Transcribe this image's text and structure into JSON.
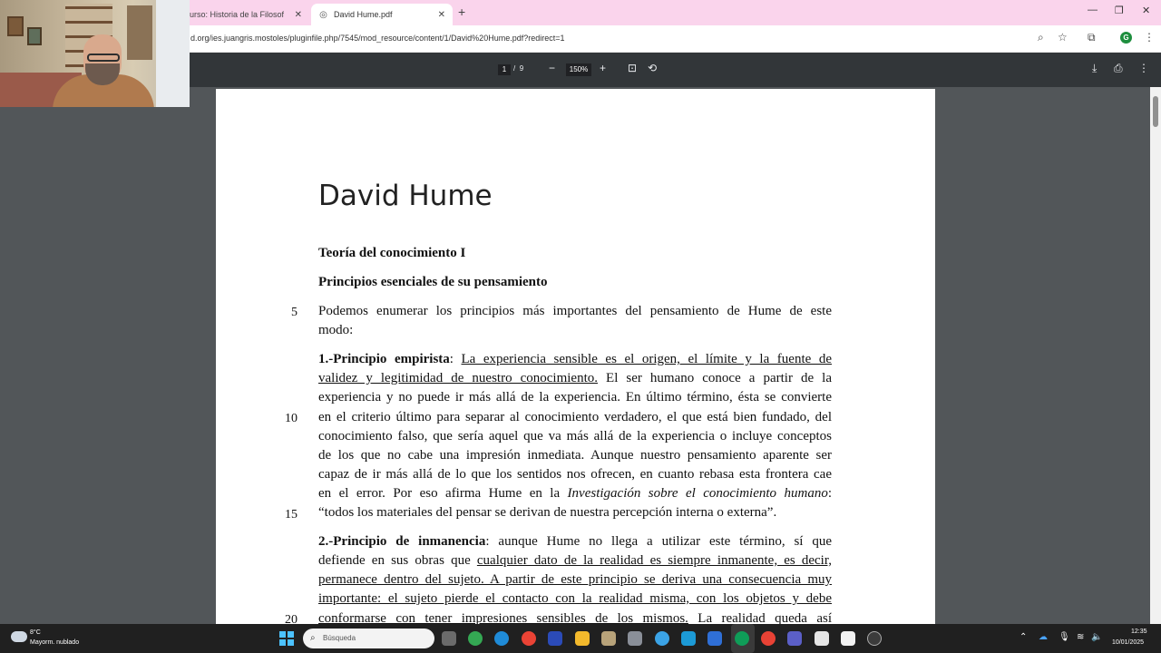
{
  "browser": {
    "tabs": [
      {
        "title": "urso: Historia de la Filosofía | ",
        "active": false
      },
      {
        "title": "David Hume.pdf",
        "active": true
      }
    ],
    "new_tab": "+",
    "url": "d.org/ies.juangris.mostoles/pluginfile.php/7545/mod_resource/content/1/David%20Hume.pdf?redirect=1",
    "profile_initial": "G"
  },
  "pdf_toolbar": {
    "current_page": "1",
    "separator": "/",
    "total_pages": "9",
    "zoom": "150%"
  },
  "document": {
    "title": "David Hume",
    "heading1": "Teoría del conocimiento I",
    "heading2": "Principios esenciales de su pensamiento",
    "intro_line1": "Podemos enumerar los principios más importantes del pensamiento de Hume de este",
    "intro_line2": "modo:",
    "p1_label": "1.-Principio empirista",
    "p1_colon": ": ",
    "p1_l1_underlined": "La experiencia sensible es el origen, el límite y la fuente de",
    "p1_l2_underlined": "validez y legitimidad de nuestro conocimiento.",
    "p1_l2_rest": " El ser humano conoce a partir de la",
    "p1_l3": "experiencia y no puede ir más allá de la experiencia. En último término, ésta se convierte",
    "p1_l4": "en el criterio último para separar al conocimiento verdadero, el que está bien fundado, del",
    "p1_l5": "conocimiento falso, que sería aquel que va más allá de la experiencia o incluye conceptos",
    "p1_l6": "de los que no cabe una impresión inmediata. Aunque nuestro pensamiento aparente ser",
    "p1_l7": "capaz de ir más allá de lo que los sentidos nos ofrecen, en cuanto rebasa esta frontera cae",
    "p1_l8_start": "en el error. Por eso afirma Hume en la ",
    "p1_l8_italic": "Investigación sobre el conocimiento humano",
    "p1_l8_end": ":",
    "p1_l9": "“todos los materiales del pensar se derivan de nuestra percepción interna o externa”.",
    "p2_label": "2.-Principio de inmanencia",
    "p2_l1_rest": ": aunque Hume no llega a utilizar este término, sí que",
    "p2_l2_start": "defiende en sus obras que ",
    "p2_l2_underlined": "cualquier dato de la realidad es siempre inmanente, es decir,",
    "p2_l3_underlined": "permanece dentro del sujeto. A partir de este principio se deriva una consecuencia muy",
    "p2_l4_underlined": "importante: el sujeto pierde el contacto con la realidad misma, con los objetos y debe",
    "p2_l5_underlined": "conformarse con tener impresiones sensibles de los mismos.",
    "p2_l5_rest": " La realidad queda así",
    "line_numbers": [
      "5",
      "10",
      "15",
      "20"
    ]
  },
  "taskbar": {
    "weather_temp": "8°C",
    "weather_desc": "Mayorm. nublado",
    "search_placeholder": "Búsqueda",
    "time": "12:35",
    "date": "10/01/2025"
  }
}
